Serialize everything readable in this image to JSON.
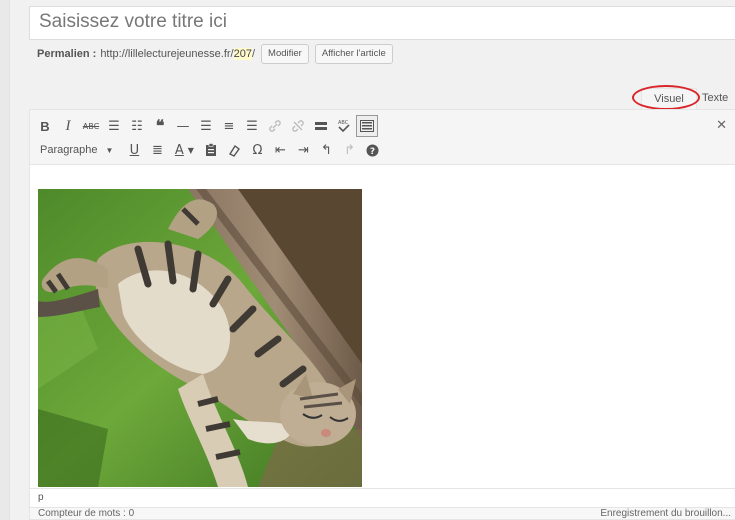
{
  "title": {
    "placeholder": "Saisissez votre titre ici"
  },
  "permalink": {
    "label": "Permalien :",
    "url_base": "http://lillelecturejeunesse.fr/",
    "slug": "207",
    "url_tail": "/",
    "edit_button": "Modifier",
    "view_button": "Afficher l'article"
  },
  "tabs": {
    "visual": "Visuel",
    "text": "Texte"
  },
  "toolbar": {
    "bold": "B",
    "italic": "I",
    "strike": "ABC",
    "format_select": "Paragraphe",
    "underline": "U",
    "text_color": "A",
    "omega": "Ω"
  },
  "icons": [
    "bold-icon",
    "italic-icon",
    "strikethrough-icon",
    "bullet-list-icon",
    "numbered-list-icon",
    "blockquote-icon",
    "horizontal-rule-icon",
    "align-left-icon",
    "align-center-icon",
    "align-right-icon",
    "link-icon",
    "unlink-icon",
    "read-more-icon",
    "spellcheck-icon",
    "toolbar-toggle-icon",
    "fullscreen-icon",
    "underline-icon",
    "justify-icon",
    "text-color-icon",
    "paste-text-icon",
    "clear-format-icon",
    "special-char-icon",
    "outdent-icon",
    "indent-icon",
    "undo-icon",
    "redo-icon",
    "help-icon"
  ],
  "editor": {
    "path": "p"
  },
  "status": {
    "word_count": "Compteur de mots : 0",
    "draft": "Enregistrement du brouillon..."
  },
  "colors": {
    "highlight_ellipse": "#d9252a",
    "slug_highlight": "#fffbcc"
  }
}
